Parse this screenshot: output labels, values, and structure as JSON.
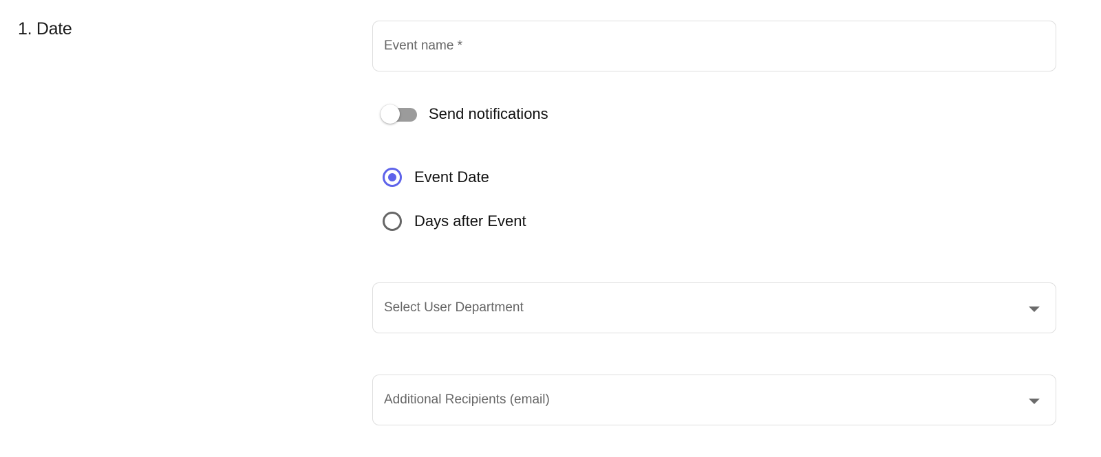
{
  "section": {
    "title": "1. Date"
  },
  "form": {
    "event_name": {
      "placeholder": "Event name *"
    },
    "notifications": {
      "label": "Send notifications",
      "enabled": false
    },
    "date_mode": {
      "options": [
        {
          "label": "Event Date",
          "selected": true
        },
        {
          "label": "Days after Event",
          "selected": false
        }
      ]
    },
    "department": {
      "placeholder": "Select User Department",
      "icon": "chevron-down-icon"
    },
    "recipients": {
      "placeholder": "Additional Recipients (email)",
      "icon": "chevron-down-icon"
    }
  },
  "colors": {
    "accent": "#5e63ea",
    "toggle_track_off": "#9b9b9b",
    "field_border": "#dedede",
    "placeholder_text": "#666666"
  }
}
